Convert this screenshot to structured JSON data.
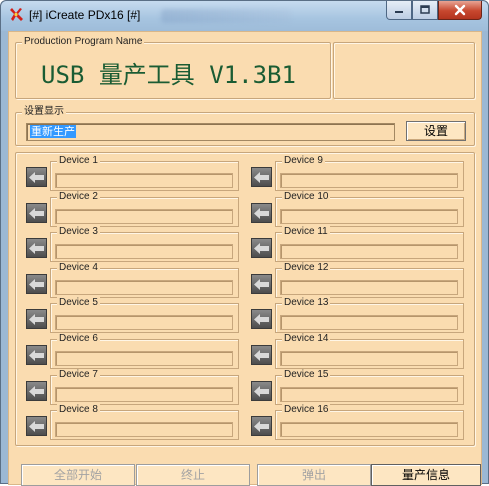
{
  "window": {
    "title": "[#] iCreate PDx16 [#]"
  },
  "program": {
    "legend": "Production Program Name",
    "name": "USB 量产工具 V1.3B1"
  },
  "settings": {
    "legend": "设置显示",
    "value": "重新生产",
    "button_label": "设置"
  },
  "devices": [
    {
      "label": "Device 1",
      "value": ""
    },
    {
      "label": "Device 2",
      "value": ""
    },
    {
      "label": "Device 3",
      "value": ""
    },
    {
      "label": "Device 4",
      "value": ""
    },
    {
      "label": "Device 5",
      "value": ""
    },
    {
      "label": "Device 6",
      "value": ""
    },
    {
      "label": "Device 7",
      "value": ""
    },
    {
      "label": "Device 8",
      "value": ""
    },
    {
      "label": "Device 9",
      "value": ""
    },
    {
      "label": "Device 10",
      "value": ""
    },
    {
      "label": "Device 11",
      "value": ""
    },
    {
      "label": "Device 12",
      "value": ""
    },
    {
      "label": "Device 13",
      "value": ""
    },
    {
      "label": "Device 14",
      "value": ""
    },
    {
      "label": "Device 15",
      "value": ""
    },
    {
      "label": "Device 16",
      "value": ""
    }
  ],
  "actions": {
    "start_all": "全部开始",
    "stop": "终止",
    "eject": "弹出",
    "info": "量产信息"
  },
  "icons": {
    "app": "tool-icon",
    "device_status": "arrow-left-icon"
  }
}
